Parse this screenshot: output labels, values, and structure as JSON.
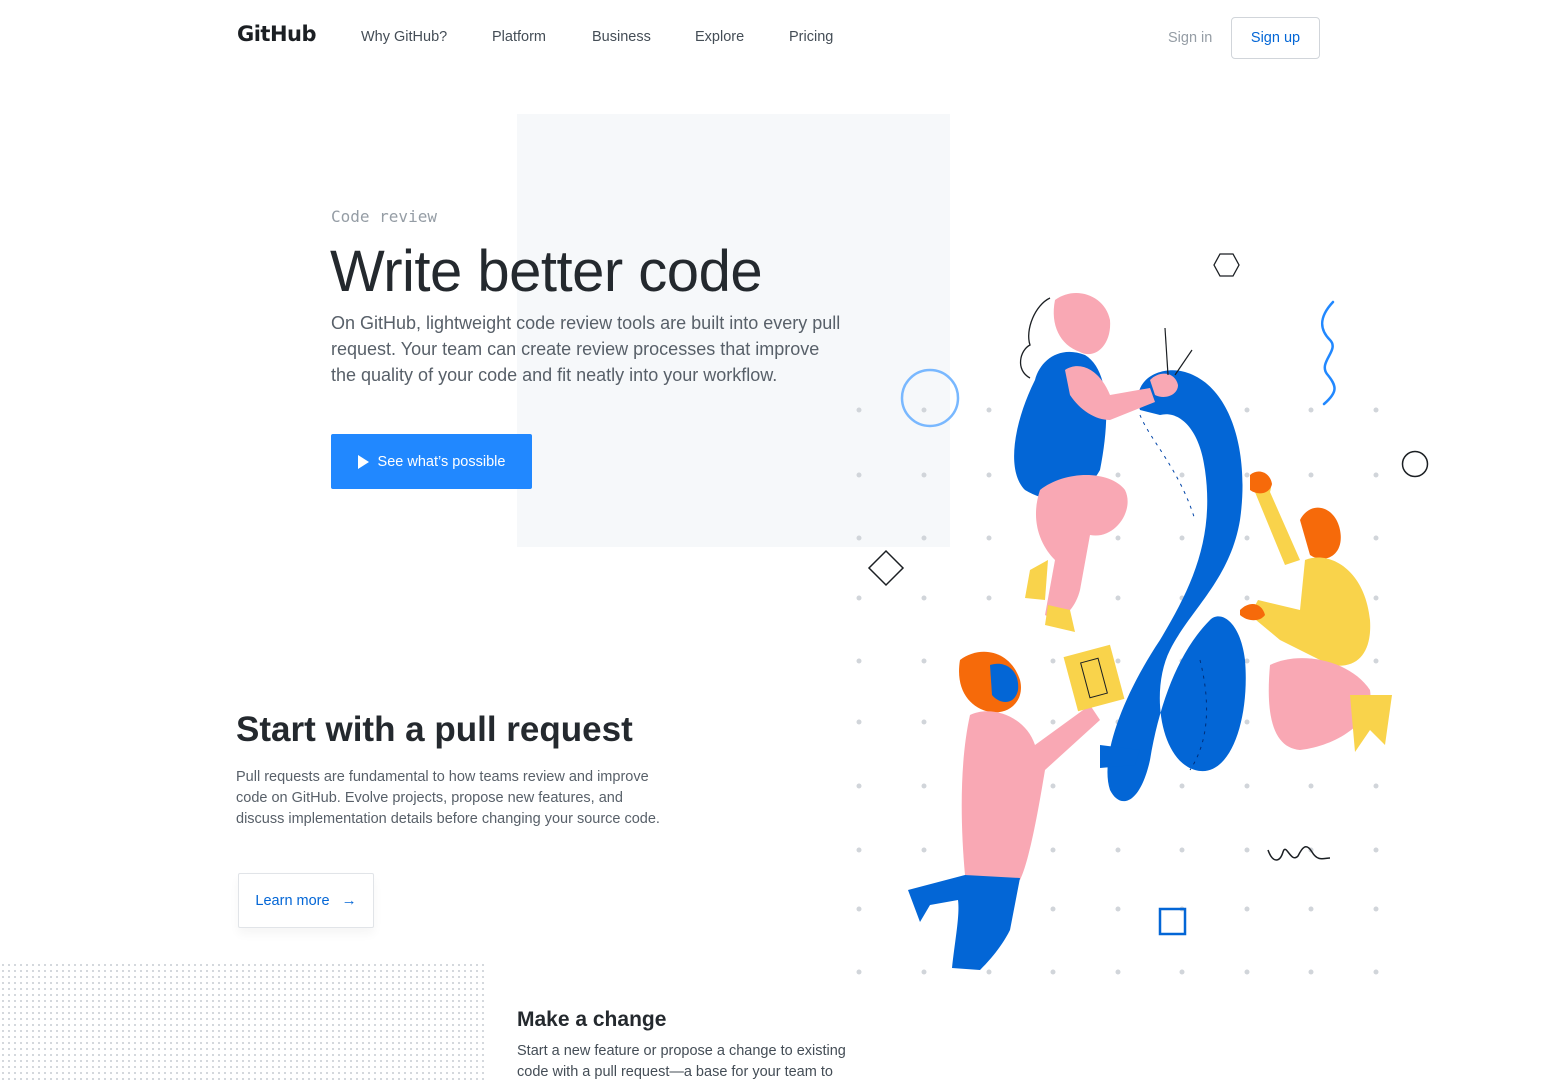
{
  "header": {
    "logo": "GitHub",
    "nav": [
      "Why GitHub?",
      "Platform",
      "Business",
      "Explore",
      "Pricing"
    ],
    "sign_in": "Sign in",
    "sign_up": "Sign up"
  },
  "hero": {
    "eyebrow": "Code review",
    "title": "Write better code",
    "description": "On GitHub, lightweight code review tools are built into every pull request. Your team can create review processes that improve the quality of your code and fit neatly into your workflow.",
    "cta_label": "See what’s possible",
    "cta_icon": "play-icon"
  },
  "section": {
    "title": "Start with a pull request",
    "description": "Pull requests are fundamental to how teams review and improve code on GitHub. Evolve projects, propose new features, and discuss implementation details before changing your source code.",
    "learn_more": "Learn more",
    "learn_more_icon": "arrow-right-icon"
  },
  "subsection": {
    "title": "Make a change",
    "description": "Start a new feature or propose a change to existing code with a pull request—a base for your team to"
  },
  "colors": {
    "accent_blue": "#2188ff",
    "link_blue": "#0366d6",
    "illustration_blue": "#0366d6",
    "pink": "#f9a8b4",
    "yellow": "#f9d34b",
    "orange": "#f66a0a",
    "text_dark": "#24292e",
    "text_muted": "#586069"
  }
}
